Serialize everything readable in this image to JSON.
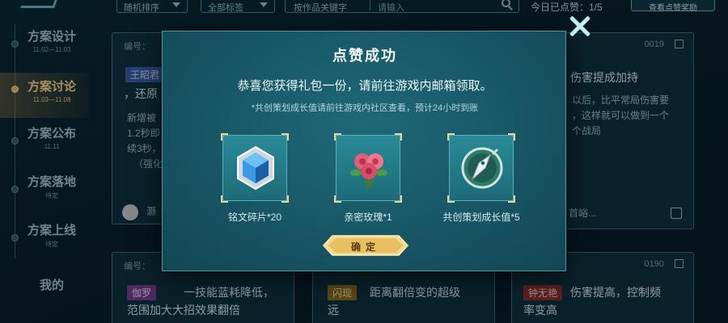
{
  "topbar": {
    "sort_label": "随机排序",
    "filter_label": "全部标签",
    "search_scope": "按作品关键字",
    "search_placeholder": "请输入",
    "liked_text": "今日已点赞：1/5",
    "reward_button": "查看点赞奖励"
  },
  "sidebar": {
    "items": [
      {
        "label": "方案设计",
        "date": "11.02—11.03"
      },
      {
        "label": "方案讨论",
        "date": "11.03—11.08"
      },
      {
        "label": "方案公布",
        "date": "11.11"
      },
      {
        "label": "方案落地",
        "date": "待定"
      },
      {
        "label": "方案上线",
        "date": "待定"
      }
    ],
    "mine_label": "我的"
  },
  "cards": {
    "top_left": {
      "number": "编号：",
      "tag": "王昭君",
      "line1": "，还原",
      "desc": [
        "新增被",
        "1.2秒即",
        "续3秒，",
        "（强化"
      ],
      "author": "灏"
    },
    "top_right": {
      "number": "0019",
      "line1": "伤害提成加持",
      "desc": [
        "以后，比平常局伤害要",
        "，这样就可以做到一个",
        "个战局"
      ],
      "author": "首峪..."
    },
    "bottom_left": {
      "number": "编号：",
      "tag": "伽罗",
      "text": [
        "一技能蓝耗降低，",
        "范围加大大招效果翻倍"
      ]
    },
    "bottom_mid": {
      "tag": "闪现",
      "text": [
        "距离翻倍变的超级",
        "远"
      ]
    },
    "bottom_right": {
      "number": "0190",
      "tag": "钟无艳",
      "text": [
        "伤害提高，控制频",
        "率变高"
      ]
    }
  },
  "modal": {
    "title": "点赞成功",
    "message": "恭喜您获得礼包一份，请前往游戏内邮箱领取。",
    "note": "*共创策划成长值请前往游戏内社区查看，预计24小时到账",
    "rewards": [
      {
        "label": "铭文碎片*20",
        "icon": "crystal-hexagon-icon"
      },
      {
        "label": "亲密玫瑰*1",
        "icon": "rose-bouquet-icon"
      },
      {
        "label": "共创策划成长值*5",
        "icon": "fountain-pen-icon"
      }
    ],
    "confirm_label": "确定"
  },
  "colors": {
    "accent_gold": "#f0c060",
    "modal_bg": "#185665",
    "close_x": "#bfeff5"
  }
}
